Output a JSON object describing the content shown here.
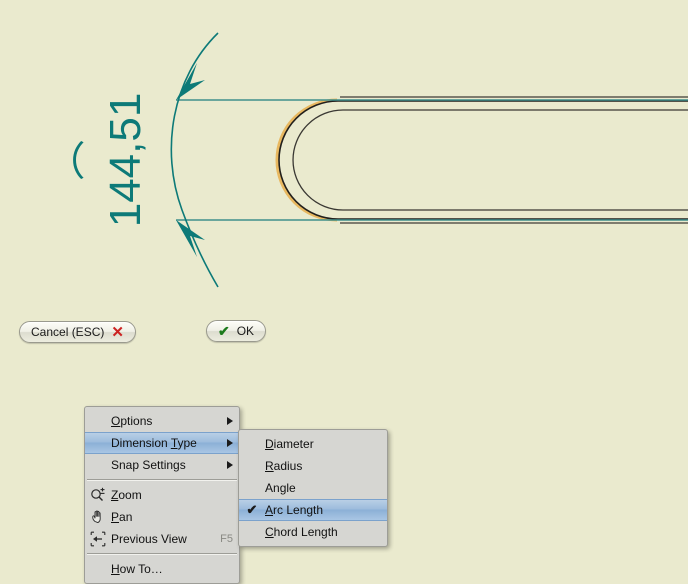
{
  "app": {
    "background_color": "#eaeace",
    "dimension_color": "#0d7a78",
    "highlight_geometry_color": "#e8b860",
    "geometry_color": "#211f1c",
    "menu_highlight_color": "#9dbcdd"
  },
  "drawing": {
    "dimension": {
      "value": "144,51",
      "type": "arc-length",
      "arc_symbol": "⌒",
      "orientation": "vertical"
    },
    "geometry_name": "slot-outline"
  },
  "command_bar": {
    "cancel": {
      "label": "Cancel (ESC)",
      "icon": "close-x-icon",
      "glyph": "✕"
    },
    "ok": {
      "label": "OK",
      "icon": "check-icon",
      "glyph": "✔"
    }
  },
  "context_menu": {
    "items": [
      {
        "label_pre": "",
        "mnemonic": "O",
        "label_post": "ptions",
        "icon": null,
        "accel": "",
        "submenu": true,
        "selected": false,
        "separator_after": false
      },
      {
        "label_pre": "Dimension ",
        "mnemonic": "T",
        "label_post": "ype",
        "icon": null,
        "accel": "",
        "submenu": true,
        "selected": true,
        "separator_after": false
      },
      {
        "label_pre": "Snap Settings",
        "mnemonic": "",
        "label_post": "",
        "icon": null,
        "accel": "",
        "submenu": true,
        "selected": false,
        "separator_after": true
      },
      {
        "label_pre": "",
        "mnemonic": "Z",
        "label_post": "oom",
        "icon": "zoom-magnifier-icon",
        "accel": "",
        "submenu": false,
        "selected": false,
        "separator_after": false
      },
      {
        "label_pre": "",
        "mnemonic": "P",
        "label_post": "an",
        "icon": "pan-hand-icon",
        "accel": "",
        "submenu": false,
        "selected": false,
        "separator_after": false
      },
      {
        "label_pre": "Previous View",
        "mnemonic": "",
        "label_post": "",
        "icon": "previous-view-icon",
        "accel": "F5",
        "submenu": false,
        "selected": false,
        "separator_after": true
      },
      {
        "label_pre": "",
        "mnemonic": "H",
        "label_post": "ow To…",
        "icon": null,
        "accel": "",
        "submenu": false,
        "selected": false,
        "separator_after": false
      }
    ]
  },
  "dimension_type_submenu": {
    "items": [
      {
        "label_pre": "",
        "mnemonic": "D",
        "label_post": "iameter",
        "checked": false,
        "selected": false
      },
      {
        "label_pre": "",
        "mnemonic": "R",
        "label_post": "adius",
        "checked": false,
        "selected": false
      },
      {
        "label_pre": "An",
        "mnemonic": "g",
        "label_post": "le",
        "checked": false,
        "selected": false
      },
      {
        "label_pre": "",
        "mnemonic": "A",
        "label_post": "rc Length",
        "checked": true,
        "selected": true
      },
      {
        "label_pre": "",
        "mnemonic": "C",
        "label_post": "hord Length",
        "checked": false,
        "selected": false
      }
    ],
    "check_glyph": "✔"
  }
}
